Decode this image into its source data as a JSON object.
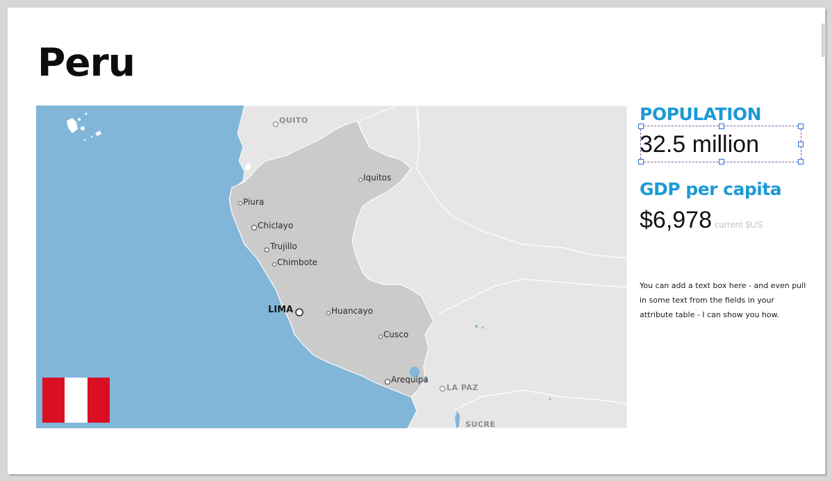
{
  "title": "Peru",
  "map": {
    "cities": [
      {
        "name": "Iquitos"
      },
      {
        "name": "Piura"
      },
      {
        "name": "Chiclayo"
      },
      {
        "name": "Trujillo"
      },
      {
        "name": "Chimbote"
      },
      {
        "name": "Huancayo"
      },
      {
        "name": "Cusco"
      },
      {
        "name": "Arequipa"
      }
    ],
    "capital": {
      "name": "LIMA"
    },
    "foreign_capitals": [
      "QUITO",
      "LA PAZ",
      "SUCRE"
    ],
    "colors": {
      "ocean": "#82b6d9",
      "peru": "#cbcbcb",
      "neighbors": "#e6e6e6",
      "borders": "#ffffff"
    }
  },
  "flag": {
    "colors": [
      "#d91023",
      "#ffffff",
      "#d91023"
    ]
  },
  "population": {
    "label": "POPULATION",
    "value": "32.5 million"
  },
  "gdp": {
    "label": "GDP per capita",
    "value": "$6,978",
    "unit": "current $US"
  },
  "note": "You can add a text  box here - and even pull in some text from the fields in your attribute table - I can show you how.",
  "accent_color": "#1c9ad6"
}
